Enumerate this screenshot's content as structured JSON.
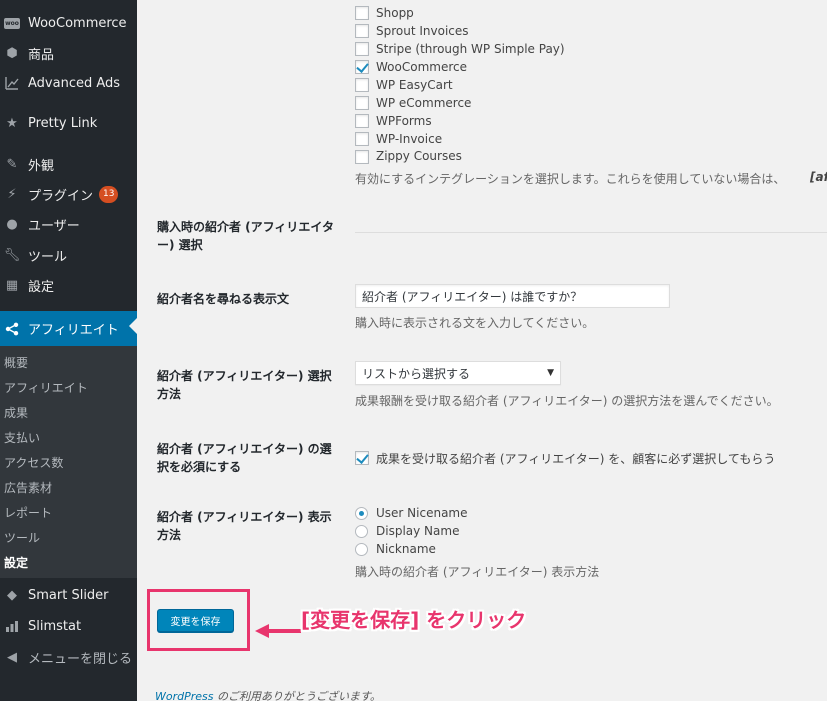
{
  "sidebar": {
    "items": [
      {
        "label": "WooCommerce",
        "icon": "woocommerce-icon"
      },
      {
        "label": "商品",
        "icon": "cube-icon"
      },
      {
        "label": "Advanced Ads",
        "icon": "chart-icon"
      },
      {
        "label": "Pretty Link",
        "icon": "star-icon"
      },
      {
        "label": "外観",
        "icon": "paintbrush-icon"
      },
      {
        "label": "プラグイン",
        "icon": "plugin-icon",
        "badge": "13"
      },
      {
        "label": "ユーザー",
        "icon": "user-icon"
      },
      {
        "label": "ツール",
        "icon": "wrench-icon"
      },
      {
        "label": "設定",
        "icon": "settings-icon"
      },
      {
        "label": "アフィリエイト",
        "icon": "share-icon"
      }
    ],
    "submenu": [
      "概要",
      "アフィリエイト",
      "成果",
      "支払い",
      "アクセス数",
      "広告素材",
      "レポート",
      "ツール",
      "設定"
    ],
    "bottom_items": [
      {
        "label": "Smart Slider",
        "icon": "graduation-icon"
      },
      {
        "label": "Slimstat",
        "icon": "bar-chart-icon"
      },
      {
        "label": "メニューを閉じる",
        "icon": "collapse-icon"
      }
    ]
  },
  "integrations": {
    "items": [
      {
        "label": "Shopp",
        "checked": false
      },
      {
        "label": "Sprout Invoices",
        "checked": false
      },
      {
        "label": "Stripe (through WP Simple Pay)",
        "checked": false
      },
      {
        "label": "WooCommerce",
        "checked": true
      },
      {
        "label": "WP EasyCart",
        "checked": false
      },
      {
        "label": "WP eCommerce",
        "checked": false
      },
      {
        "label": "WPForms",
        "checked": false
      },
      {
        "label": "WP-Invoice",
        "checked": false
      },
      {
        "label": "Zippy Courses",
        "checked": false
      }
    ],
    "description": "有効にするインテグレーションを選択します。これらを使用していない場合は、",
    "description_tail": "[af"
  },
  "settings": {
    "referral_section_label": "購入時の紹介者 (アフィリエイター) 選択",
    "prompt_label": "紹介者名を尋ねる表示文",
    "prompt_value": "紹介者 (アフィリエイター) は誰ですか？",
    "prompt_desc": "購入時に表示される文を入力してください。",
    "method_label": "紹介者 (アフィリエイター) 選択方法",
    "method_value": "リストから選択する",
    "method_desc": "成果報酬を受け取る紹介者 (アフィリエイター) の選択方法を選んでください。",
    "required_label": "紹介者 (アフィリエイター) の選択を必須にする",
    "required_checkbox": "成果を受け取る紹介者 (アフィリエイター) を、顧客に必ず選択してもらう",
    "display_label": "紹介者 (アフィリエイター) 表示方法",
    "display_options": [
      "User Nicename",
      "Display Name",
      "Nickname"
    ],
    "display_desc": "購入時の紹介者 (アフィリエイター) 表示方法"
  },
  "save_button": "変更を保存",
  "annotation": "[変更を保存] をクリック",
  "footer": {
    "link": "WordPress",
    "text": " のご利用ありがとうございます。"
  },
  "colors": {
    "accent": "#0073aa",
    "highlight": "#e8356d",
    "sidebar": "#23282d"
  }
}
